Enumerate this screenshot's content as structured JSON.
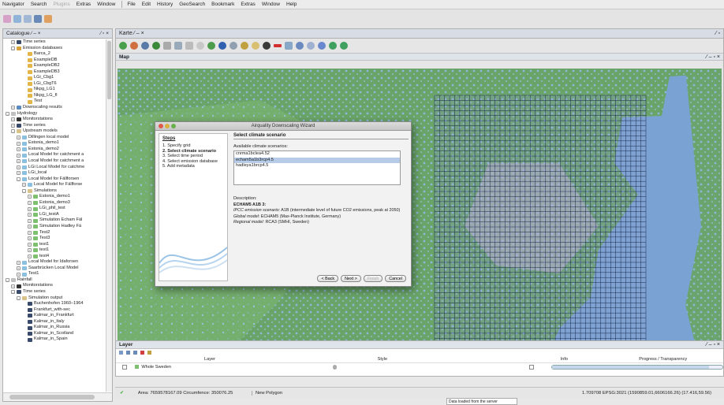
{
  "menubar": {
    "left": [
      {
        "label": "Navigator",
        "dis": false
      },
      {
        "label": "Search",
        "dis": false
      },
      {
        "label": "Plugins",
        "dis": true
      },
      {
        "label": "Extras",
        "dis": false
      },
      {
        "label": "Window",
        "dis": false
      }
    ],
    "right": [
      "File",
      "Edit",
      "History",
      "GeoSearch",
      "Bookmark",
      "Extras",
      "Window",
      "Help"
    ]
  },
  "catalogue": {
    "tab_label": "Catalogue ⁄ – ×",
    "tab_controls": "⁄ ▫ ×",
    "tree": [
      {
        "d": 1,
        "ex": "+",
        "c": "#3a4a6a",
        "t": "Time series"
      },
      {
        "d": 1,
        "ex": "–",
        "c": "#d8a23a",
        "t": "Emission databases"
      },
      {
        "d": 3,
        "ex": "",
        "c": "#e3b64a",
        "t": "Barca_2"
      },
      {
        "d": 3,
        "ex": "",
        "c": "#e3b64a",
        "t": "ExampleDB"
      },
      {
        "d": 3,
        "ex": "",
        "c": "#e3b64a",
        "t": "ExampleDB2"
      },
      {
        "d": 3,
        "ex": "",
        "c": "#e3b64a",
        "t": "ExampleDB3"
      },
      {
        "d": 3,
        "ex": "",
        "c": "#e3b64a",
        "t": "LGi_Cbg1"
      },
      {
        "d": 3,
        "ex": "",
        "c": "#e3b64a",
        "t": "LGi_CbgT6"
      },
      {
        "d": 3,
        "ex": "",
        "c": "#e3b64a",
        "t": "Nkpg_LG1"
      },
      {
        "d": 3,
        "ex": "",
        "c": "#e3b64a",
        "t": "Nkpg_LG_fl"
      },
      {
        "d": 3,
        "ex": "",
        "c": "#e3b64a",
        "t": "Test"
      },
      {
        "d": 1,
        "ex": "+",
        "c": "#5a8ac0",
        "t": "Downscaling results"
      },
      {
        "d": 0,
        "ex": "–",
        "c": "#c0c0c0",
        "t": "Hydrology"
      },
      {
        "d": 1,
        "ex": "+",
        "c": "#333",
        "t": "Monitorstations"
      },
      {
        "d": 1,
        "ex": "+",
        "c": "#3a4a6a",
        "t": "Time series"
      },
      {
        "d": 1,
        "ex": "–",
        "c": "#d8c28a",
        "t": "Upstream models"
      },
      {
        "d": 2,
        "ex": "+",
        "c": "#8cc0e0",
        "t": "Dillingen local model"
      },
      {
        "d": 2,
        "ex": "+",
        "c": "#8cc0e0",
        "t": "Estonia_demo1"
      },
      {
        "d": 2,
        "ex": "+",
        "c": "#8cc0e0",
        "t": "Estonia_demo2"
      },
      {
        "d": 2,
        "ex": "+",
        "c": "#8cc0e0",
        "t": "Local Model for catchment a"
      },
      {
        "d": 2,
        "ex": "+",
        "c": "#8cc0e0",
        "t": "Local Model for catchment a"
      },
      {
        "d": 2,
        "ex": "+",
        "c": "#8cc0e0",
        "t": "LGi Local Model for catchme"
      },
      {
        "d": 2,
        "ex": "+",
        "c": "#8cc0e0",
        "t": "LGi_local"
      },
      {
        "d": 2,
        "ex": "–",
        "c": "#8cc0e0",
        "t": "Local Model for Fällforsen"
      },
      {
        "d": 3,
        "ex": "+",
        "c": "#8cc0e0",
        "t": "Local Model for Fällforse"
      },
      {
        "d": 3,
        "ex": "–",
        "c": "#d8c28a",
        "t": "Simulations"
      },
      {
        "d": 4,
        "ex": "+",
        "c": "#7cc070",
        "t": "Estonia_demo1"
      },
      {
        "d": 4,
        "ex": "+",
        "c": "#7cc070",
        "t": "Estonia_demo3"
      },
      {
        "d": 4,
        "ex": "+",
        "c": "#7cc070",
        "t": "LGi_phil_test"
      },
      {
        "d": 4,
        "ex": "+",
        "c": "#7cc070",
        "t": "LGi_testA"
      },
      {
        "d": 4,
        "ex": "+",
        "c": "#7cc070",
        "t": "Simulation Echam Fäl"
      },
      {
        "d": 4,
        "ex": "+",
        "c": "#7cc070",
        "t": "Simulation Hadley Fä"
      },
      {
        "d": 4,
        "ex": "+",
        "c": "#7cc070",
        "t": "Test2"
      },
      {
        "d": 4,
        "ex": "+",
        "c": "#7cc070",
        "t": "Test3"
      },
      {
        "d": 4,
        "ex": "+",
        "c": "#7cc070",
        "t": "test1"
      },
      {
        "d": 4,
        "ex": "+",
        "c": "#7cc070",
        "t": "test1"
      },
      {
        "d": 4,
        "ex": "+",
        "c": "#7cc070",
        "t": "test4"
      },
      {
        "d": 2,
        "ex": "+",
        "c": "#8cc0e0",
        "t": "Local Model for Idaforsen"
      },
      {
        "d": 2,
        "ex": "+",
        "c": "#8cc0e0",
        "t": "Saarbrücken Local Model"
      },
      {
        "d": 2,
        "ex": "+",
        "c": "#8cc0e0",
        "t": "Test1"
      },
      {
        "d": 0,
        "ex": "–",
        "c": "#c0c0c0",
        "t": "Rainfall"
      },
      {
        "d": 1,
        "ex": "+",
        "c": "#333",
        "t": "Monitorstations"
      },
      {
        "d": 1,
        "ex": "–",
        "c": "#3a4a6a",
        "t": "Time series"
      },
      {
        "d": 2,
        "ex": "–",
        "c": "#d8c28a",
        "t": "Simulation output"
      },
      {
        "d": 3,
        "ex": "",
        "c": "#3a4a6a",
        "t": "Buchenhofen 1960–1964"
      },
      {
        "d": 3,
        "ex": "",
        "c": "#3a4a6a",
        "t": "Frankfurt_with-sec"
      },
      {
        "d": 3,
        "ex": "",
        "c": "#3a4a6a",
        "t": "Kalmar_in_Frankfurt"
      },
      {
        "d": 3,
        "ex": "",
        "c": "#3a4a6a",
        "t": "Kalmar_in_Italy"
      },
      {
        "d": 3,
        "ex": "",
        "c": "#3a4a6a",
        "t": "Kalmar_in_Russia"
      },
      {
        "d": 3,
        "ex": "",
        "c": "#3a4a6a",
        "t": "Kalmar_in_Scotland"
      },
      {
        "d": 3,
        "ex": "",
        "c": "#3a4a6a",
        "t": "Kalmar_in_Spain"
      }
    ]
  },
  "map_tab": {
    "label": "Karte ⁄ – ×",
    "controls": "⁄ ▫"
  },
  "map_header": {
    "title": "Map",
    "controls": "⁄ – ▫ ×"
  },
  "wizard": {
    "title": "Airquality Downscaling Wizard",
    "steps_title": "Steps",
    "steps": [
      {
        "label": "1.  Specify grid",
        "bold": false
      },
      {
        "label": "2.  Select climate scenario",
        "bold": true
      },
      {
        "label": "3.  Select time period",
        "bold": false
      },
      {
        "label": "4.  Select emission database",
        "bold": false
      },
      {
        "label": "5.  Add metadata",
        "bold": false
      }
    ],
    "section_title": "Select climate scenario",
    "available_label": "Available climate scenarios:",
    "scenarios": [
      {
        "label": "cnrma1bclea4.52",
        "selected": false
      },
      {
        "label": "echam5a1b3rcp4.5",
        "selected": true
      },
      {
        "label": "hadleya1brcp4.5",
        "selected": false
      }
    ],
    "desc_label": "Description:",
    "desc_title": "ECHAM5 A1B 3:",
    "desc_lines": [
      {
        "k": "IPCC emission scenario:",
        "v": " A1B (intermediate level of future CO2 emissions, peak at 2050)"
      },
      {
        "k": "Global model:",
        "v": " ECHAM5 (Max-Planck Institute, Germany)"
      },
      {
        "k": "Regional model:",
        "v": " RCA3 (SMHI, Sweden)"
      }
    ],
    "btn_back": "< Back",
    "btn_next": "Next >",
    "btn_finish": "Finish",
    "btn_cancel": "Cancel"
  },
  "layer_panel": {
    "title": "Layer",
    "controls": "⁄ – ▫ ×",
    "col_layer": "Layer",
    "col_style": "Style",
    "col_info": "Info",
    "col_progress": "Progress / Transparency",
    "row_name": "Whole Sweden",
    "transparency": 0.92
  },
  "statusbar": {
    "area": "Area: 7659578167.09 Circumfence: 350076.25",
    "polygon": "New Polygon",
    "coords": "1.709708 EPSG:3021 (1590859.01,6606166.26) (17.416,59.56)"
  },
  "tooltip": "Data loaded from the server",
  "colors": {
    "map_water": "#7aa3d4",
    "map_land": "#6fa86b",
    "grid": "#1a2a4a",
    "select": "#b6cbe8"
  }
}
